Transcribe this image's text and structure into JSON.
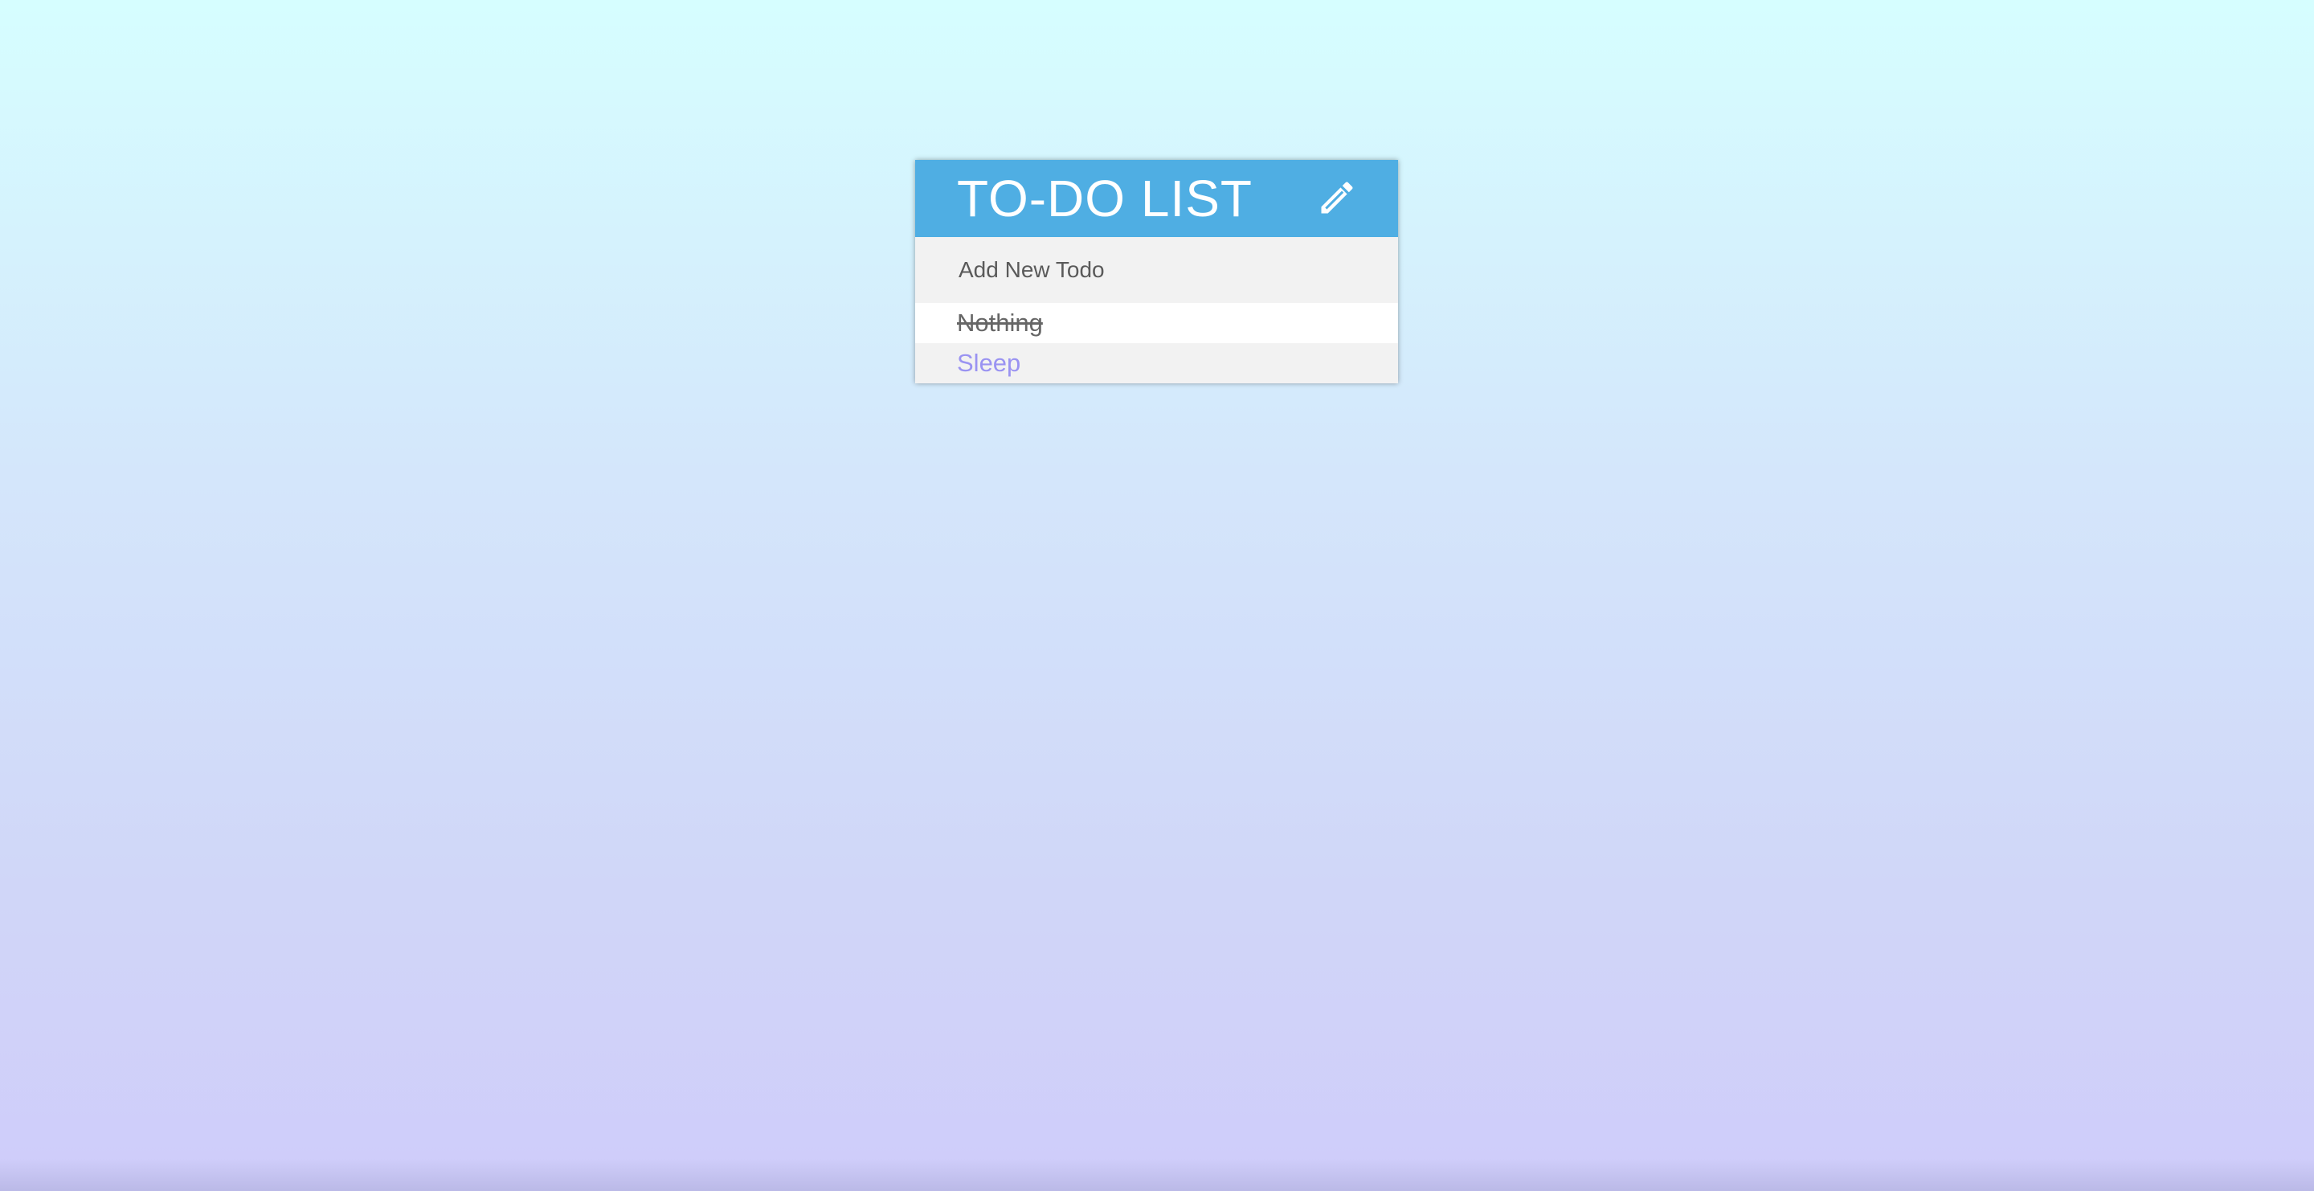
{
  "app": {
    "title": "TO-DO LIST",
    "edit_icon": "pencil-icon"
  },
  "new_todo": {
    "placeholder": "Add New Todo",
    "value": ""
  },
  "todos": [
    {
      "text": "Nothing",
      "completed": true
    },
    {
      "text": "Sleep",
      "completed": false
    }
  ],
  "colors": {
    "header_bg": "#4faee3",
    "header_text": "#ffffff",
    "input_bg": "#f2f2f2",
    "completed_text": "#666666",
    "active_text": "#9a93f2",
    "background_top": "#d6feff",
    "background_bottom": "#cfccfa"
  }
}
